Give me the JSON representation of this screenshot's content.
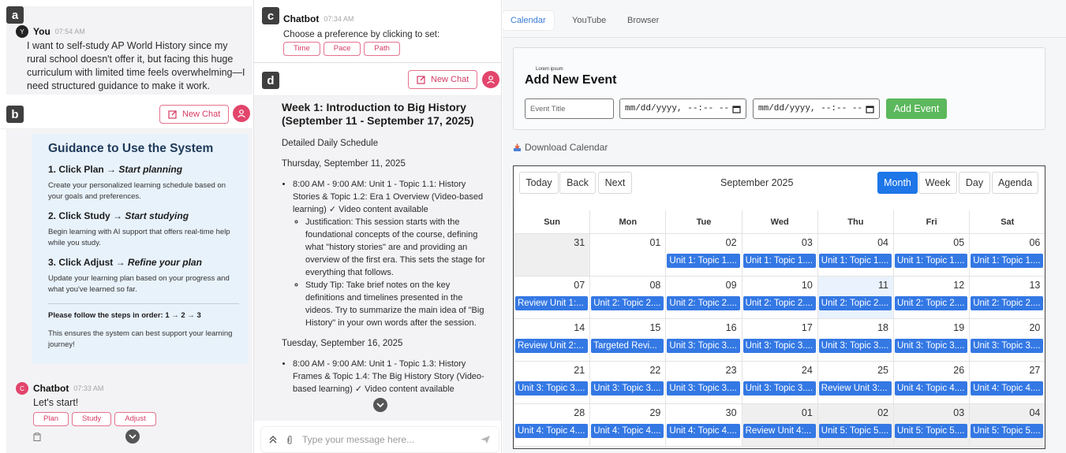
{
  "tags": {
    "a": "a",
    "b": "b",
    "c": "c",
    "d": "d"
  },
  "panel_a": {
    "sender": "You",
    "avatar": "Y",
    "time": "07:54 AM",
    "text": "I want to self-study AP World History since my rural school doesn't offer it, but facing this huge curriculum with limited time feels overwhelming—I need structured guidance to make it work."
  },
  "panel_b": {
    "new_chat": "New Chat",
    "guide": {
      "title": "Guidance to Use the System",
      "steps": [
        {
          "label": "1. Click Plan →",
          "action": "Start planning",
          "desc": "Create your personalized learning schedule based on your goals and preferences."
        },
        {
          "label": "2. Click Study →",
          "action": "Start studying",
          "desc": "Begin learning with AI support that offers real-time help while you study."
        },
        {
          "label": "3. Click Adjust →",
          "action": "Refine your plan",
          "desc": "Update your learning plan based on your progress and what you've learned so far."
        }
      ],
      "order": "Please follow the steps in order: 1 → 2 → 3",
      "footer": "This ensures the system can best support your learning journey!"
    },
    "bot": {
      "avatar": "C",
      "sender": "Chatbot",
      "time": "07:33 AM",
      "text": "Let's start!",
      "buttons": [
        "Plan",
        "Study",
        "Adjust"
      ]
    }
  },
  "panel_c": {
    "sender": "Chatbot",
    "time": "07:34 AM",
    "text": "Choose a preference by clicking to set:",
    "buttons": [
      "Time",
      "Pace",
      "Path"
    ]
  },
  "panel_d": {
    "new_chat": "New Chat",
    "heading": "Week 1: Introduction to Big History (September 11 - September 17, 2025)",
    "subheading": "Detailed Daily Schedule",
    "day1": "Thursday, September 11, 2025",
    "item1": "8:00 AM - 9:00 AM: Unit 1 - Topic 1.1: History Stories & Topic 1.2: Era 1 Overview (Video-based learning) ✓ Video content available",
    "justification": "Justification: This session starts with the foundational concepts of the course, defining what \"history stories\" are and providing an overview of the first era. This sets the stage for everything that follows.",
    "tip": "Study Tip: Take brief notes on the key definitions and timelines presented in the videos. Try to summarize the main idea of \"Big History\" in your own words after the session.",
    "day2": "Tuesday, September 16, 2025",
    "item2": "8:00 AM - 9:00 AM: Unit 1 - Topic 1.3: History Frames & Topic 1.4: The Big History Story (Video-based learning) ✓ Video content available",
    "input_placeholder": "Type your message here..."
  },
  "browser": {
    "tabs": [
      "Calendar",
      "YouTube",
      "Browser"
    ],
    "active_tab": "Calendar",
    "event_form": {
      "small_label": "Lorem ipsum",
      "title": "Add New Event",
      "title_placeholder": "Event Title",
      "start_value": "mm/dd/yyyy, --:-- --",
      "end_value": "mm/dd/yyyy, --:-- --",
      "submit": "Add Event"
    },
    "download": "Download Calendar",
    "calendar": {
      "toolbar_left": [
        "Today",
        "Back",
        "Next"
      ],
      "month_label": "September 2025",
      "views": [
        "Month",
        "Week",
        "Day",
        "Agenda"
      ],
      "active_view": "Month",
      "days": [
        "Sun",
        "Mon",
        "Tue",
        "Wed",
        "Thu",
        "Fri",
        "Sat"
      ],
      "weeks": [
        {
          "dates": [
            "31",
            "01",
            "02",
            "03",
            "04",
            "05",
            "06"
          ],
          "events": [
            "",
            "",
            "Unit 1: Topic 1....",
            "Unit 1: Topic 1....",
            "Unit 1: Topic 1....",
            "Unit 1: Topic 1....",
            "Unit 1: Topic 1...."
          ]
        },
        {
          "dates": [
            "07",
            "08",
            "09",
            "10",
            "11",
            "12",
            "13"
          ],
          "events": [
            "Review Unit 1:...",
            "Unit 2: Topic 2....",
            "Unit 2: Topic 2....",
            "Unit 2: Topic 2....",
            "Unit 2: Topic 2....",
            "Unit 2: Topic 2....",
            "Unit 2: Topic 2...."
          ]
        },
        {
          "dates": [
            "14",
            "15",
            "16",
            "17",
            "18",
            "19",
            "20"
          ],
          "events": [
            "Review Unit 2:...",
            "Targeted Revi...",
            "Unit 3: Topic 3....",
            "Unit 3: Topic 3....",
            "Unit 3: Topic 3....",
            "Unit 3: Topic 3....",
            "Unit 3: Topic 3...."
          ]
        },
        {
          "dates": [
            "21",
            "22",
            "23",
            "24",
            "25",
            "26",
            "27"
          ],
          "events": [
            "Unit 3: Topic 3....",
            "Unit 3: Topic 3....",
            "Unit 3: Topic 3....",
            "Unit 3: Topic 3....",
            "Review Unit 3:...",
            "Unit 4: Topic 4....",
            "Unit 4: Topic 4...."
          ]
        },
        {
          "dates": [
            "28",
            "29",
            "30",
            "01",
            "02",
            "03",
            "04"
          ],
          "events": [
            "Unit 4: Topic 4....",
            "Unit 4: Topic 4....",
            "Unit 4: Topic 4....",
            "Review Unit 4:...",
            "Unit 5: Topic 5....",
            "Unit 5: Topic 5....",
            "Unit 5: Topic 5...."
          ]
        }
      ],
      "today_date": "11",
      "accent": "#1e76e8",
      "event_color": "#3478e4"
    }
  }
}
